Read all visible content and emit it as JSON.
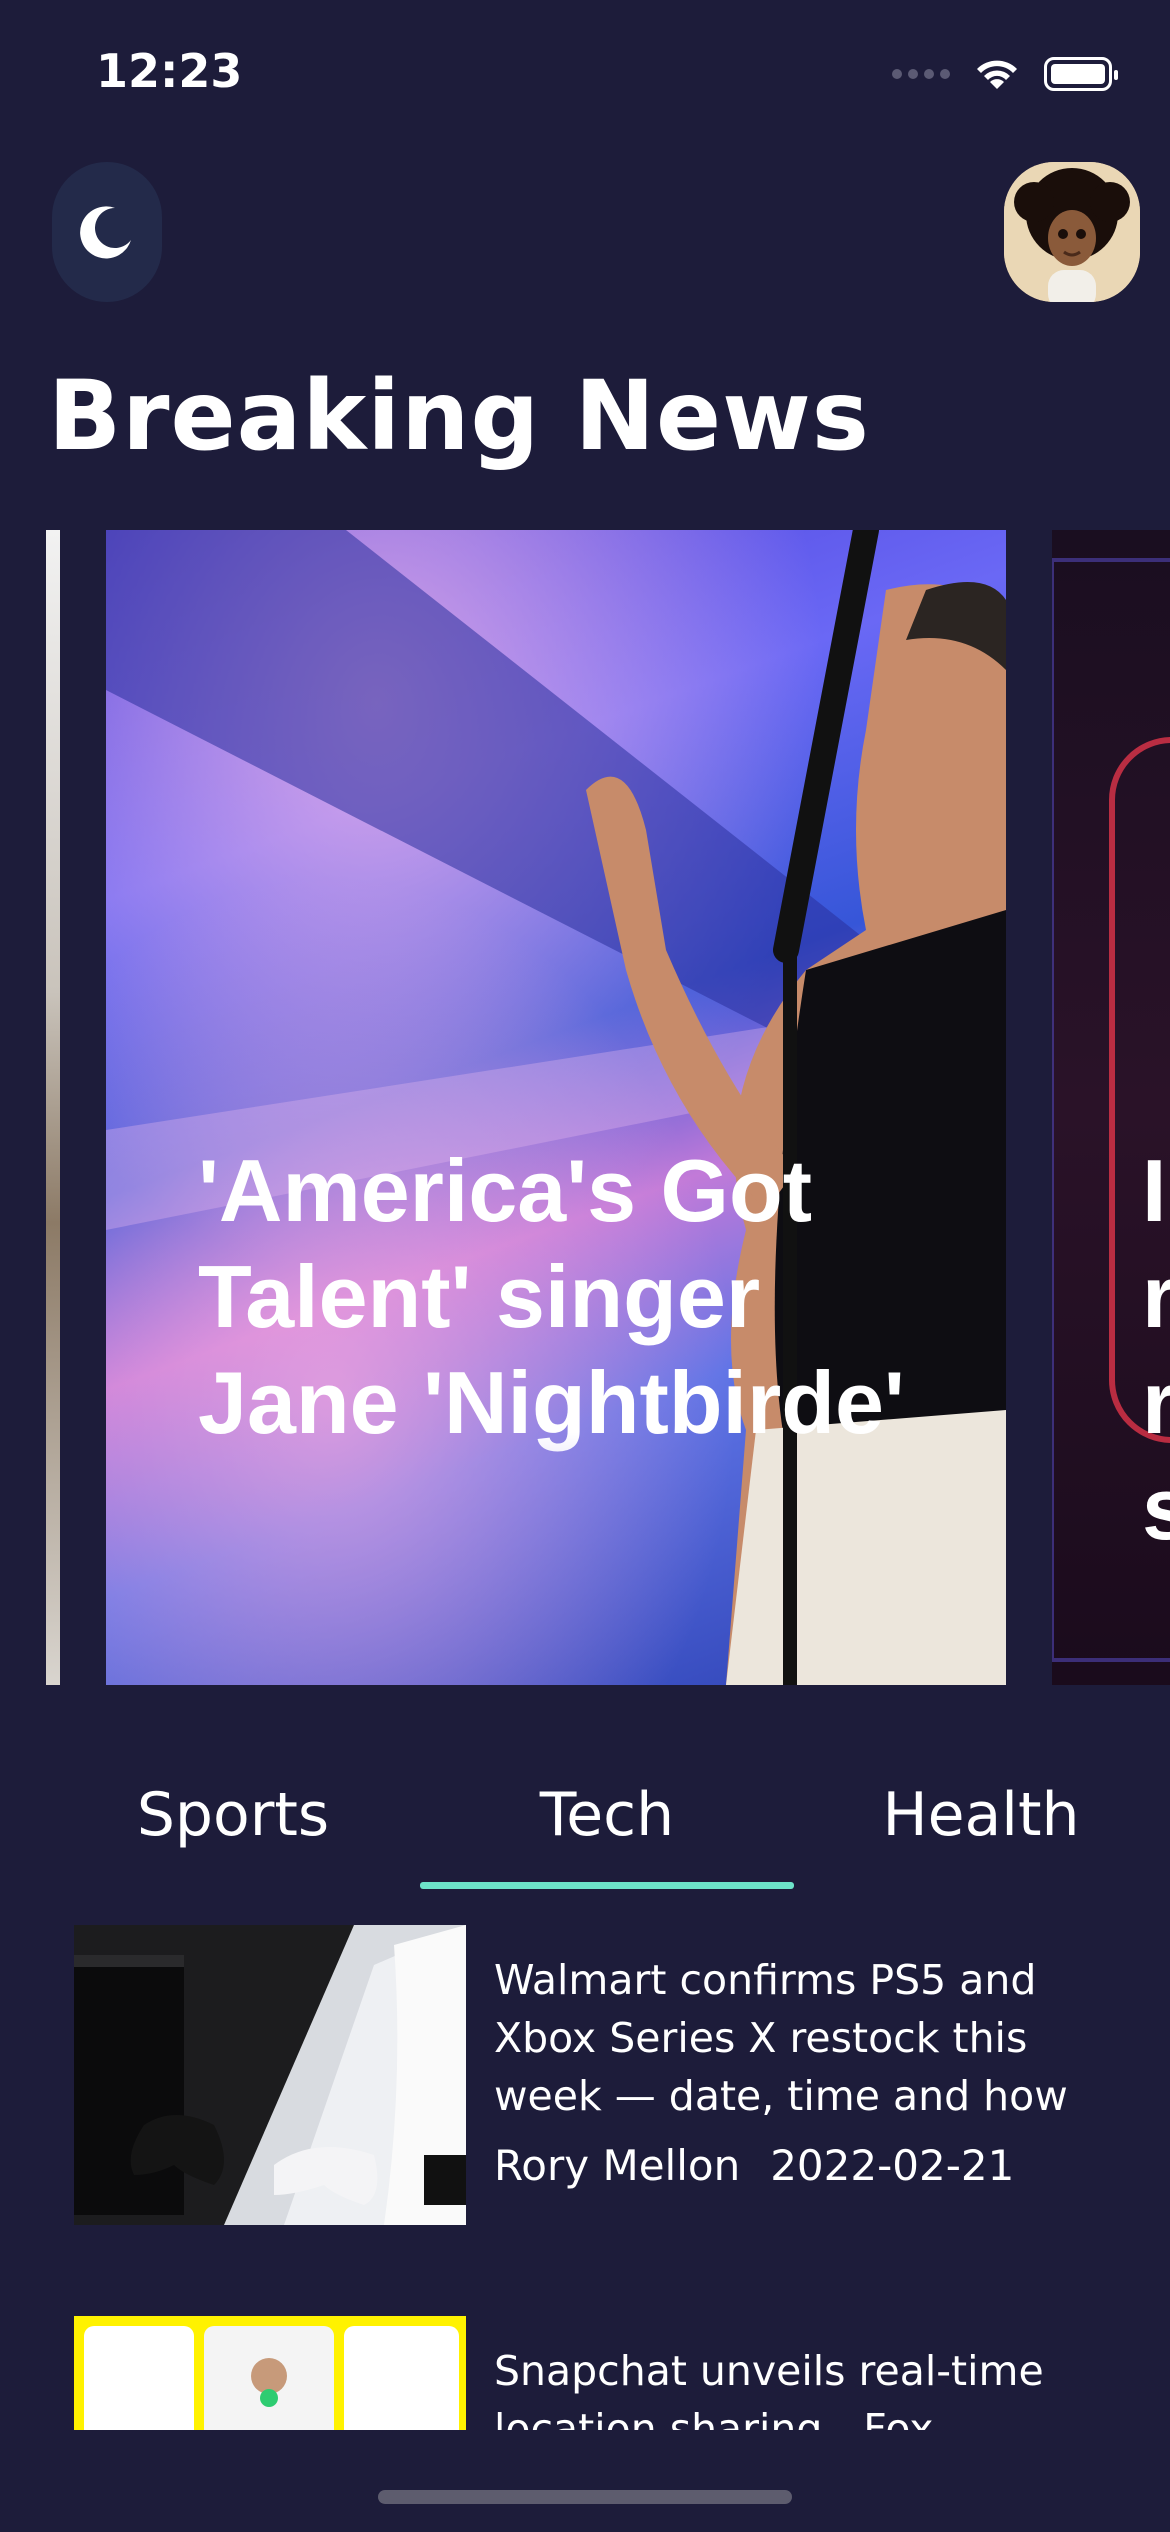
{
  "status": {
    "time": "12:23"
  },
  "header": {
    "title": "Breaking News"
  },
  "carousel": {
    "cards": [
      {
        "title": "'America's Got Talent' singer Jane 'Nightbirde'"
      },
      {
        "title": "I\nr\nr\ns"
      }
    ]
  },
  "tabs": [
    {
      "label": "Sports"
    },
    {
      "label": "Tech"
    },
    {
      "label": "Health"
    }
  ],
  "articles": [
    {
      "title": "Walmart confirms PS5 and Xbox Series X restock this week — date, time and how",
      "author": "Rory Mellon",
      "date": "2022-02-21"
    },
    {
      "title": "Snapchat unveils real-time location sharing - Fox"
    }
  ],
  "colors": {
    "background": "#1d1c3a",
    "accent": "#6de3c9",
    "toggle_bg": "#232a4a"
  }
}
